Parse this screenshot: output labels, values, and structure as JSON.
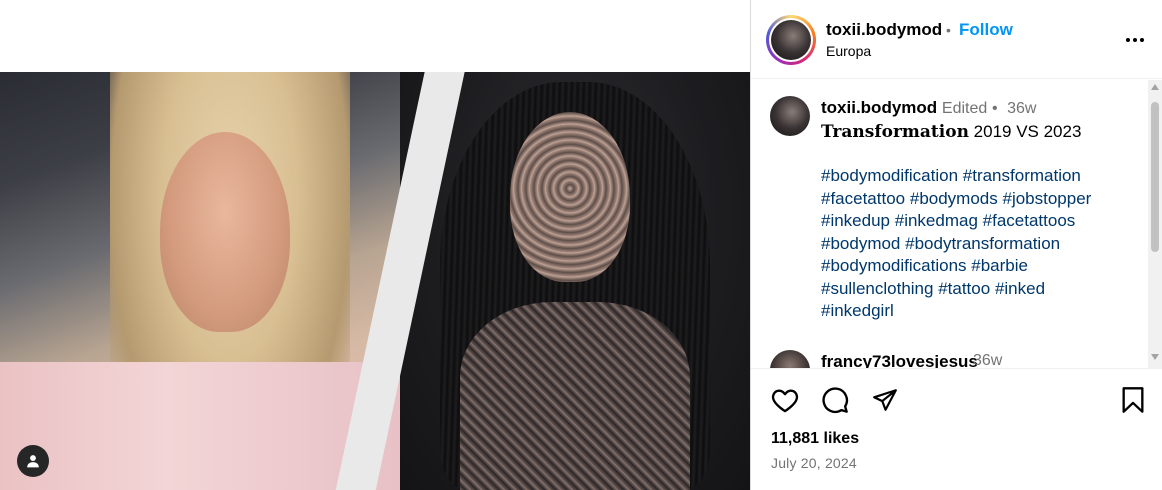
{
  "post": {
    "username": "toxii.bodymod",
    "follow_label": "Follow",
    "separator": "•",
    "location": "Europa"
  },
  "caption": {
    "username": "toxii.bodymod",
    "edited": "Edited",
    "separator": "•",
    "time": "36w",
    "title_bold": "Transformation",
    "title_rest": " 2019 VS 2023",
    "hashtags": [
      "#bodymodification",
      "#transformation",
      "#facetattoo",
      "#bodymods",
      "#jobstopper",
      "#inkedup",
      "#inkedmag",
      "#facetattoos",
      "#bodymod",
      "#bodytransformation",
      "#bodymodifications",
      "#barbie",
      "#sullenclothing",
      "#tattoo",
      "#inked",
      "#inkedgirl"
    ]
  },
  "comment2": {
    "username": "francy73lovesjesus",
    "time": "36w"
  },
  "stats": {
    "likes": "11,881 likes",
    "date": "July 20, 2024"
  },
  "icons": {
    "more": "more-options-icon",
    "like": "heart-icon",
    "comment": "comment-icon",
    "share": "share-icon",
    "save": "bookmark-icon",
    "user_tags": "user-tag-icon"
  },
  "colors": {
    "follow": "#0095f6",
    "hashtag": "#00376b",
    "secondary_text": "#737373"
  }
}
